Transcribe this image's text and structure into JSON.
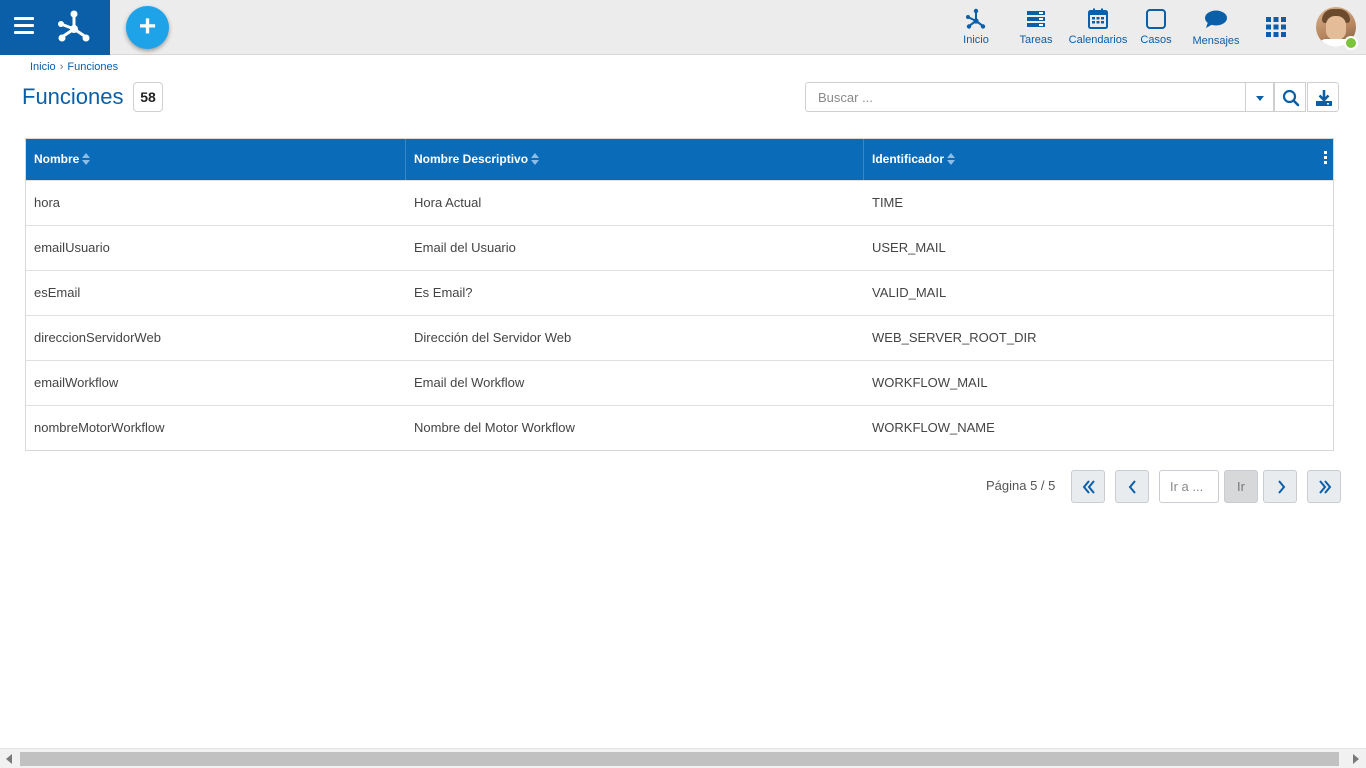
{
  "topbar": {
    "nav": [
      {
        "label": "Inicio",
        "icon": "home-network-icon"
      },
      {
        "label": "Tareas",
        "icon": "tasks-icon"
      },
      {
        "label": "Calendarios",
        "icon": "calendar-icon"
      },
      {
        "label": "Casos",
        "icon": "cases-icon"
      },
      {
        "label": "Mensajes",
        "icon": "message-icon"
      }
    ],
    "add_label": "+"
  },
  "breadcrumb": {
    "home": "Inicio",
    "separator": "›",
    "current": "Funciones"
  },
  "page": {
    "title": "Funciones",
    "count": "58"
  },
  "search": {
    "placeholder": "Buscar ..."
  },
  "table": {
    "columns": [
      "Nombre",
      "Nombre Descriptivo",
      "Identificador"
    ],
    "rows": [
      [
        "hora",
        "Hora Actual",
        "TIME"
      ],
      [
        "emailUsuario",
        "Email del Usuario",
        "USER_MAIL"
      ],
      [
        "esEmail",
        "Es Email?",
        "VALID_MAIL"
      ],
      [
        "direccionServidorWeb",
        "Dirección del Servidor Web",
        "WEB_SERVER_ROOT_DIR"
      ],
      [
        "emailWorkflow",
        "Email del Workflow",
        "WORKFLOW_MAIL"
      ],
      [
        "nombreMotorWorkflow",
        "Nombre del Motor Workflow",
        "WORKFLOW_NAME"
      ]
    ]
  },
  "pagination": {
    "info": "Página 5 / 5",
    "goto_placeholder": "Ir a ...",
    "go_label": "Ir"
  },
  "colors": {
    "brand": "#0a5fa8",
    "header": "#0a6bb8",
    "fab": "#1ea2e8",
    "status_online": "#7cc43b"
  }
}
